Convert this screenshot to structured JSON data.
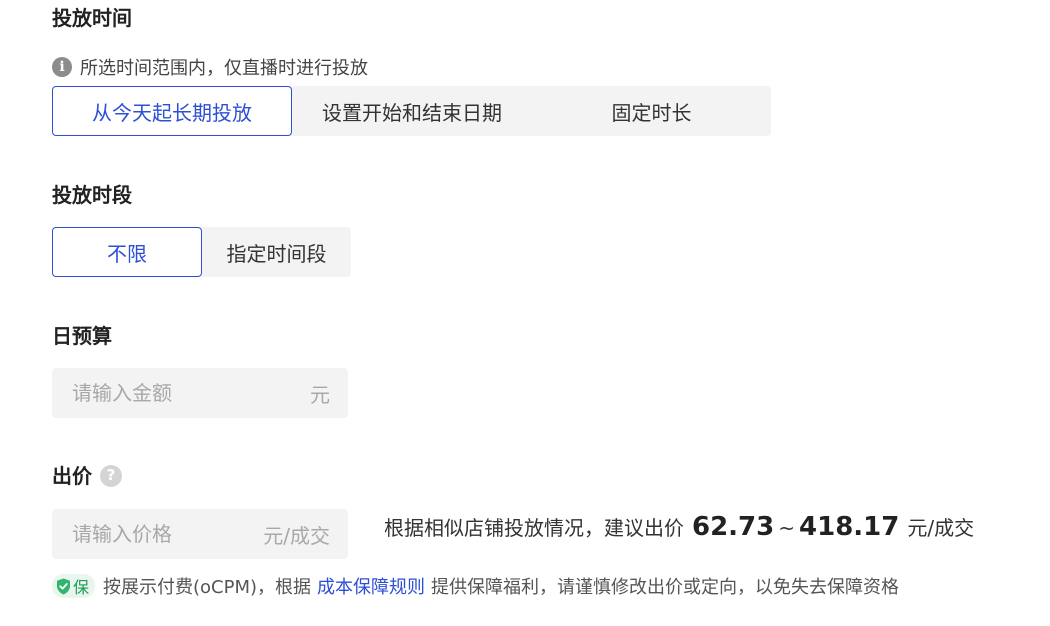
{
  "schedule": {
    "title": "投放时间",
    "info": "所选时间范围内，仅直播时进行投放",
    "options": [
      "从今天起长期投放",
      "设置开始和结束日期",
      "固定时长"
    ],
    "selected": "从今天起长期投放"
  },
  "period": {
    "title": "投放时段",
    "options": [
      "不限",
      "指定时间段"
    ],
    "selected": "不限"
  },
  "budget": {
    "title": "日预算",
    "placeholder": "请输入金额",
    "suffix": "元"
  },
  "bid": {
    "title": "出价",
    "help_icon": "question-icon",
    "placeholder": "请输入价格",
    "suffix": "元/成交",
    "suggestion_prefix": "根据相似店铺投放情况，建议出价",
    "min": "62.73",
    "separator": "~",
    "max": "418.17",
    "suggestion_unit": "元/成交"
  },
  "guarantee": {
    "badge": "保",
    "text_before": "按展示付费(oCPM)，根据",
    "link": "成本保障规则",
    "text_after": "提供保障福利，请谨慎修改出价或定向，以免失去保障资格"
  },
  "colors": {
    "accent": "#2d4fd6",
    "guarantee_green": "#1f9b5a"
  }
}
